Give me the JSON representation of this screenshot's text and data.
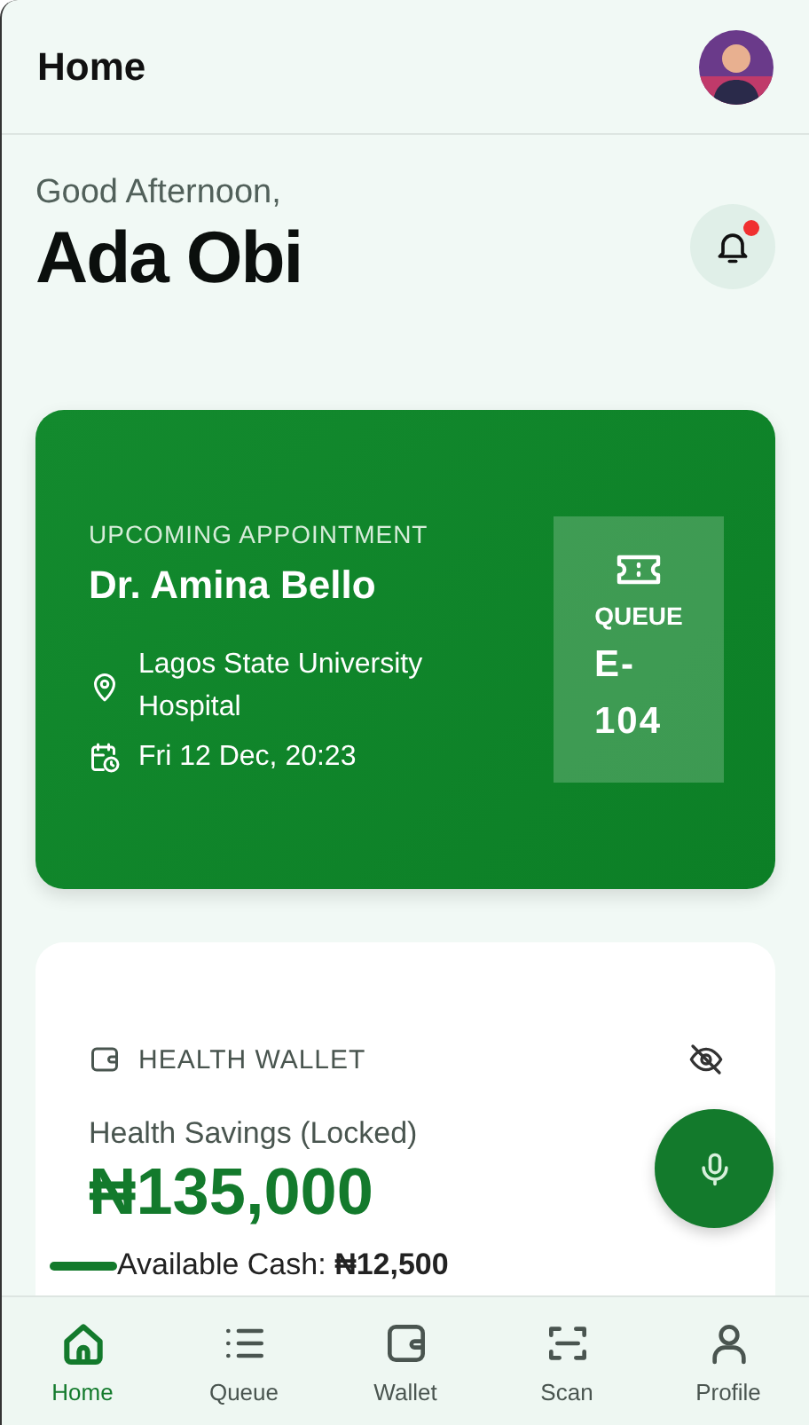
{
  "header": {
    "title": "Home"
  },
  "greeting": {
    "salutation": "Good Afternoon,",
    "name": "Ada Obi",
    "has_unread_notifications": true
  },
  "appointment": {
    "label": "UPCOMING APPOINTMENT",
    "doctor": "Dr. Amina Bello",
    "location": "Lagos State University Hospital",
    "datetime": "Fri 12 Dec, 20:23",
    "queue_label": "QUEUE",
    "queue_number": "E-104"
  },
  "wallet": {
    "title": "HEALTH WALLET",
    "savings_label": "Health Savings (Locked)",
    "savings_amount": "₦135,000",
    "available_label": "Available Cash:",
    "available_amount": "₦12,500"
  },
  "nav": [
    {
      "label": "Home",
      "kind": "home",
      "selected": true
    },
    {
      "label": "Queue",
      "kind": "list",
      "selected": false
    },
    {
      "label": "Wallet",
      "kind": "wallet",
      "selected": false
    },
    {
      "label": "Scan",
      "kind": "scan",
      "selected": false
    },
    {
      "label": "Profile",
      "kind": "profile",
      "selected": false
    }
  ]
}
